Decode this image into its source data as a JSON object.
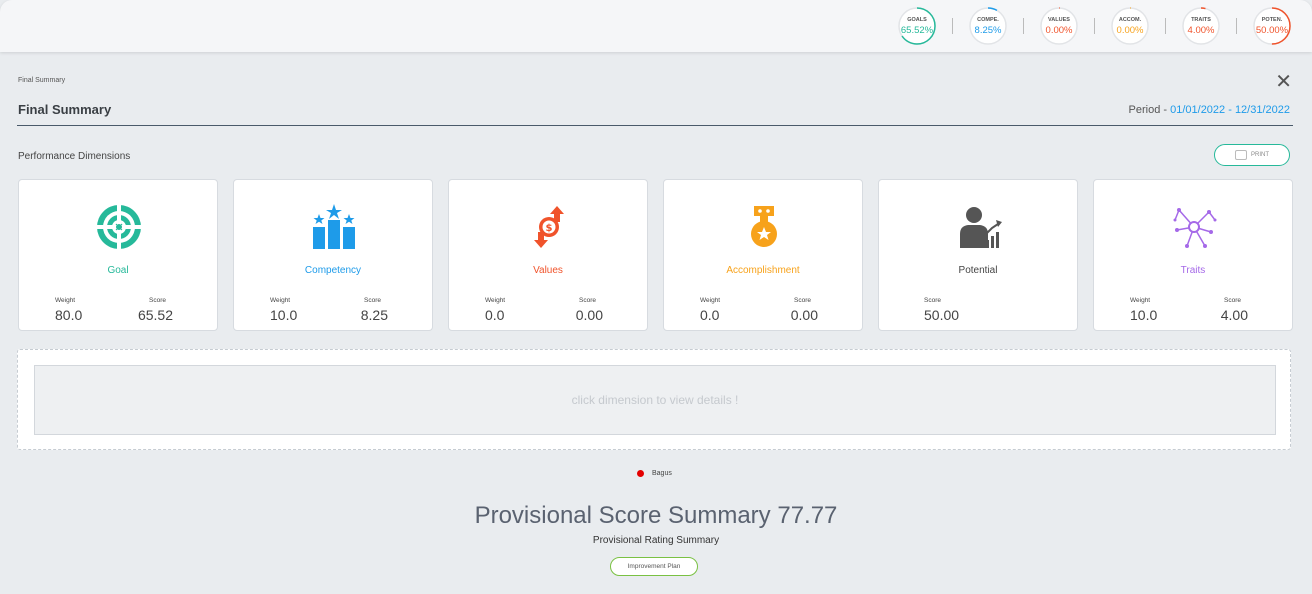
{
  "top_badges": [
    {
      "label": "GOALS",
      "value": "65.52%",
      "color": "#26b99a",
      "percent": 65.52
    },
    {
      "label": "COMPE.",
      "value": "8.25%",
      "color": "#1e9be9",
      "percent": 8.25
    },
    {
      "label": "VALUES",
      "value": "0.00%",
      "color": "#f0532b",
      "percent": 0
    },
    {
      "label": "ACCOM.",
      "value": "0.00%",
      "color": "#f7a21b",
      "percent": 0
    },
    {
      "label": "TRAITS",
      "value": "4.00%",
      "color": "#f0532b",
      "percent": 4
    },
    {
      "label": "POTEN.",
      "value": "50.00%",
      "color": "#f0532b",
      "percent": 50
    }
  ],
  "breadcrumb": "Final Summary",
  "title": "Final Summary",
  "period": {
    "label": "Period - ",
    "dates": "01/01/2022 - 12/31/2022"
  },
  "section_label": "Performance Dimensions",
  "print_label": "PRINT",
  "cards": [
    {
      "name": "Goal",
      "color": "#26b99a",
      "icon": "target-icon",
      "weight_label": "Weight",
      "weight": "80.0",
      "score_label": "Score",
      "score": "65.52"
    },
    {
      "name": "Competency",
      "color": "#1e9be9",
      "icon": "podium-stars-icon",
      "weight_label": "Weight",
      "weight": "10.0",
      "score_label": "Score",
      "score": "8.25"
    },
    {
      "name": "Values",
      "color": "#f0532b",
      "icon": "money-exchange-icon",
      "weight_label": "Weight",
      "weight": "0.0",
      "score_label": "Score",
      "score": "0.00"
    },
    {
      "name": "Accomplishment",
      "color": "#f7a21b",
      "icon": "medal-icon",
      "weight_label": "Weight",
      "weight": "0.0",
      "score_label": "Score",
      "score": "0.00"
    },
    {
      "name": "Potential",
      "color": "#444444",
      "icon": "growth-person-icon",
      "score_label": "Score",
      "score": "50.00"
    },
    {
      "name": "Traits",
      "color": "#a569e8",
      "icon": "network-icon",
      "weight_label": "Weight",
      "weight": "10.0",
      "score_label": "Score",
      "score": "4.00"
    }
  ],
  "details_placeholder": "click dimension to view details !",
  "legend": {
    "label": "Bagus",
    "color": "#e40000"
  },
  "provisional_score": "Provisional Score Summary  77.77",
  "provisional_rating": "Provisional Rating Summary",
  "improvement_label": "Improvement Plan"
}
